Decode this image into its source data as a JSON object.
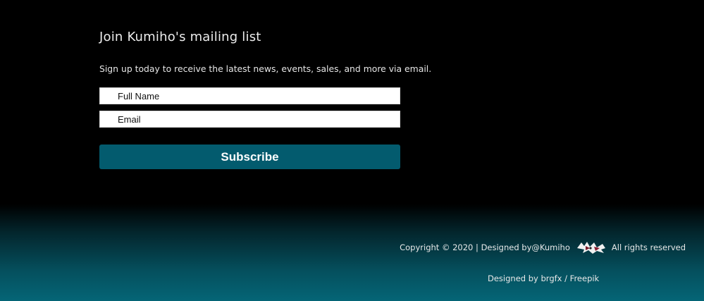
{
  "signup": {
    "title": "Join Kumiho's mailing list",
    "description": "Sign up today to receive the latest news, events, sales, and more via email.",
    "full_name_placeholder": "Full Name",
    "email_placeholder": "Email",
    "subscribe_label": "Subscribe"
  },
  "footer": {
    "copyright_prefix": "Copyright © 2020 | Designed by@Kumiho",
    "logo_icon": "kumiho-logo-icon",
    "rights": "All rights reserved",
    "credit": "Designed by brgfx / Freepik"
  },
  "colors": {
    "background_top": "#000000",
    "background_bottom": "#056576",
    "button": "#035b6e",
    "text": "#e8e8e8"
  }
}
